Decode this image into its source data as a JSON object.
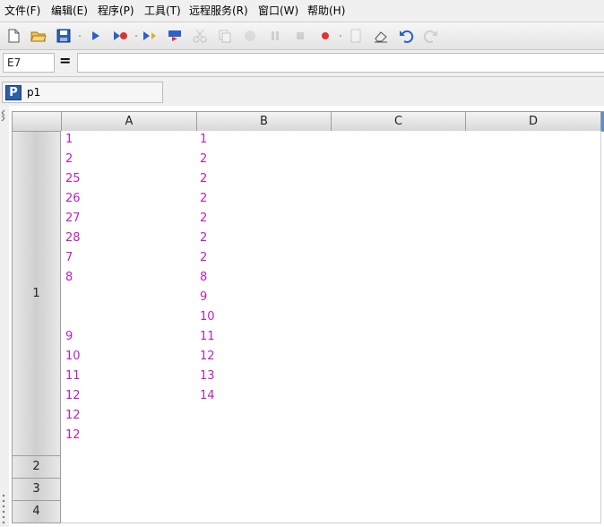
{
  "menu": [
    "文件(F)",
    "编辑(E)",
    "程序(P)",
    "工具(T)",
    "远程服务(R)",
    "窗口(W)",
    "帮助(H)"
  ],
  "toolbar_icons": [
    "new-file-icon",
    "open-folder-icon",
    "save-icon",
    "run-icon",
    "run-to-breakpoint-icon",
    "step-run-icon",
    "debug-step-icon",
    "cut-icon",
    "copy-icon",
    "stop-circle-icon",
    "pause-icon",
    "stop-icon",
    "record-icon",
    "page-icon",
    "eraser-icon",
    "undo-icon",
    "redo-icon"
  ],
  "formula_bar": {
    "cell_ref": "E7",
    "equals": "=",
    "formula": ""
  },
  "sheet": {
    "icon_letter": "P",
    "name": "p1"
  },
  "columns": [
    "A",
    "B",
    "C",
    "D"
  ],
  "rows": [
    "1",
    "2",
    "3",
    "4"
  ],
  "cells": {
    "A1": [
      "1",
      "2",
      "25",
      "26",
      "27",
      "28",
      "7",
      "8",
      "",
      "",
      "9",
      "10",
      "11",
      "12",
      "12",
      "12"
    ],
    "B1": [
      "1",
      "2",
      "2",
      "2",
      "2",
      "2",
      "2",
      "8",
      "9",
      "10",
      "11",
      "12",
      "13",
      "14"
    ]
  },
  "colors": {
    "value_text": "#c020c0",
    "accent_blue": "#2b5fa8"
  }
}
